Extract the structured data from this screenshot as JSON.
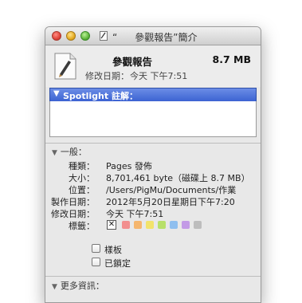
{
  "window": {
    "title_open_quote": "“",
    "title_name": "參觀報告",
    "title_suffix": "”簡介"
  },
  "header": {
    "doc_name": "參觀報告",
    "doc_size": "8.7 MB",
    "modified_label": "修改日期：",
    "modified_value": "今天 下午7:51"
  },
  "spotlight": {
    "label": "Spotlight 註解："
  },
  "general": {
    "header": "一般：",
    "rows": [
      {
        "label": "種類：",
        "value": "Pages 發佈"
      },
      {
        "label": "大小：",
        "value": "8,701,461 byte（磁碟上 8.7 MB）"
      },
      {
        "label": "位置：",
        "value": "/Users/PigMu/Documents/作業"
      },
      {
        "label": "製作日期：",
        "value": "2012年5月20日星期日下午7:20"
      },
      {
        "label": "修改日期：",
        "value": "今天 下午7:51"
      }
    ],
    "tags_label": "標籤：",
    "tag_none_glyph": "✕",
    "tag_colors": [
      "#f28f8f",
      "#f5b66e",
      "#f2e36b",
      "#b8e06a",
      "#8fbfef",
      "#c39be6",
      "#bdbdbd"
    ],
    "stationery_label": "樣板",
    "locked_label": "已鎖定"
  },
  "more_info": {
    "header": "更多資訊："
  }
}
